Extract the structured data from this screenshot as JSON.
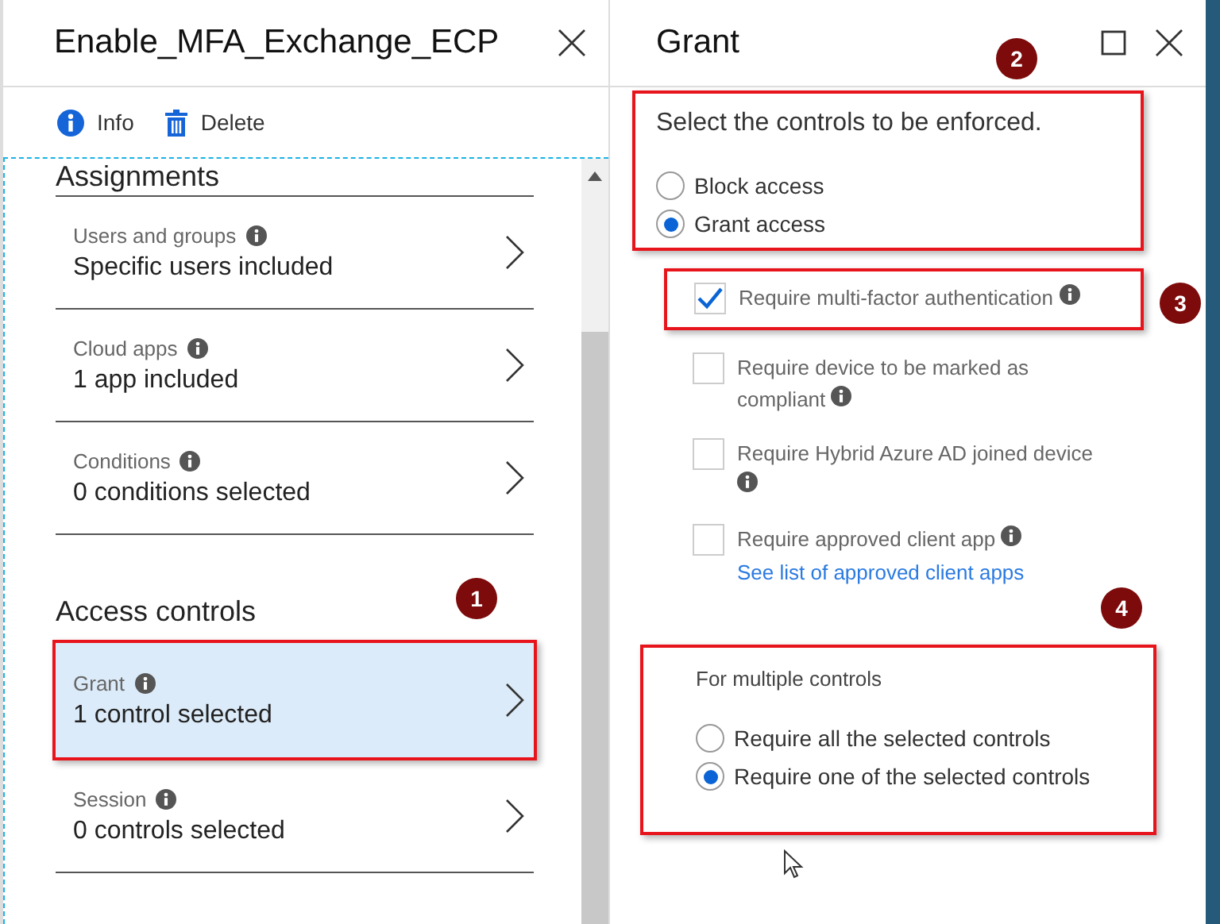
{
  "policy_blade": {
    "title": "Enable_MFA_Exchange_ECP",
    "toolbar": [
      {
        "label": "Info",
        "kind": "info"
      },
      {
        "label": "Delete",
        "kind": "delete"
      }
    ],
    "sections": [
      {
        "heading": "Assignments",
        "items": [
          {
            "label": "Users and groups",
            "value": "Specific users included",
            "selected": false
          },
          {
            "label": "Cloud apps",
            "value": "1 app included",
            "selected": false
          },
          {
            "label": "Conditions",
            "value": "0 conditions selected",
            "selected": false
          }
        ]
      },
      {
        "heading": "Access controls",
        "items": [
          {
            "label": "Grant",
            "value": "1 control selected",
            "selected": true
          },
          {
            "label": "Session",
            "value": "0 controls selected",
            "selected": false
          }
        ]
      }
    ]
  },
  "grant_blade": {
    "title": "Grant",
    "prompt": "Select the controls to be enforced.",
    "access_options": [
      {
        "label": "Block access",
        "selected": false
      },
      {
        "label": "Grant access",
        "selected": true
      }
    ],
    "controls": [
      {
        "label": "Require multi-factor authentication",
        "checked": true
      },
      {
        "label": "Require device to be marked as compliant",
        "checked": false
      },
      {
        "label": "Require Hybrid Azure AD joined device",
        "checked": false
      },
      {
        "label": "Require approved client app",
        "checked": false,
        "link": "See list of approved client apps"
      }
    ],
    "multiple_heading": "For multiple controls",
    "multiple_options": [
      {
        "label": "Require all the selected controls",
        "selected": false
      },
      {
        "label": "Require one of the selected controls",
        "selected": true
      }
    ]
  },
  "annotations": [
    "1",
    "2",
    "3",
    "4"
  ]
}
